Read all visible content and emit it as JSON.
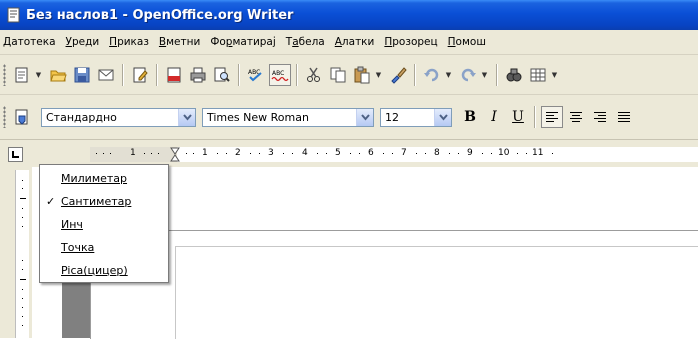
{
  "window": {
    "title": "Без наслов1 - OpenOffice.org Writer",
    "title_color": "#0a4fd6"
  },
  "menubar": {
    "items": [
      {
        "label": "Датотека",
        "accel": "Д"
      },
      {
        "label": "Уреди",
        "accel": "У"
      },
      {
        "label": "Приказ",
        "accel": "П"
      },
      {
        "label": "Вметни",
        "accel": "В"
      },
      {
        "label": "Форматирај",
        "accel": "Ф"
      },
      {
        "label": "Табела",
        "accel": "Т"
      },
      {
        "label": "Алатки",
        "accel": "А"
      },
      {
        "label": "Прозорец",
        "accel": "П"
      },
      {
        "label": "Помош",
        "accel": "П"
      }
    ]
  },
  "toolbar_standard": {
    "icons": [
      "new-document-icon",
      "open-folder-icon",
      "save-icon",
      "email-icon",
      "edit-file-icon",
      "export-pdf-icon",
      "print-icon",
      "page-preview-icon",
      "spellcheck-icon",
      "autospellcheck-icon",
      "cut-icon",
      "copy-icon",
      "paste-icon",
      "format-paintbrush-icon",
      "undo-icon",
      "redo-icon",
      "navigator-icon",
      "table-icon"
    ]
  },
  "toolbar_formatting": {
    "paragraph_style": "Стандардно",
    "font_name": "Times New Roman",
    "font_size": "12",
    "bold_label": "B",
    "italic_label": "I",
    "underline_label": "U"
  },
  "ruler": {
    "labels": [
      "1",
      "1",
      "2",
      "3",
      "4",
      "5",
      "6",
      "7",
      "8",
      "9",
      "10",
      "11"
    ]
  },
  "context_menu": {
    "items": [
      {
        "label": "Милиметар",
        "checked": false
      },
      {
        "label": "Сантиметар",
        "checked": true
      },
      {
        "label": "Инч",
        "checked": false
      },
      {
        "label": "Точка",
        "checked": false
      },
      {
        "label": "Pica(цицер)",
        "checked": false
      }
    ],
    "check_glyph": "✓"
  }
}
